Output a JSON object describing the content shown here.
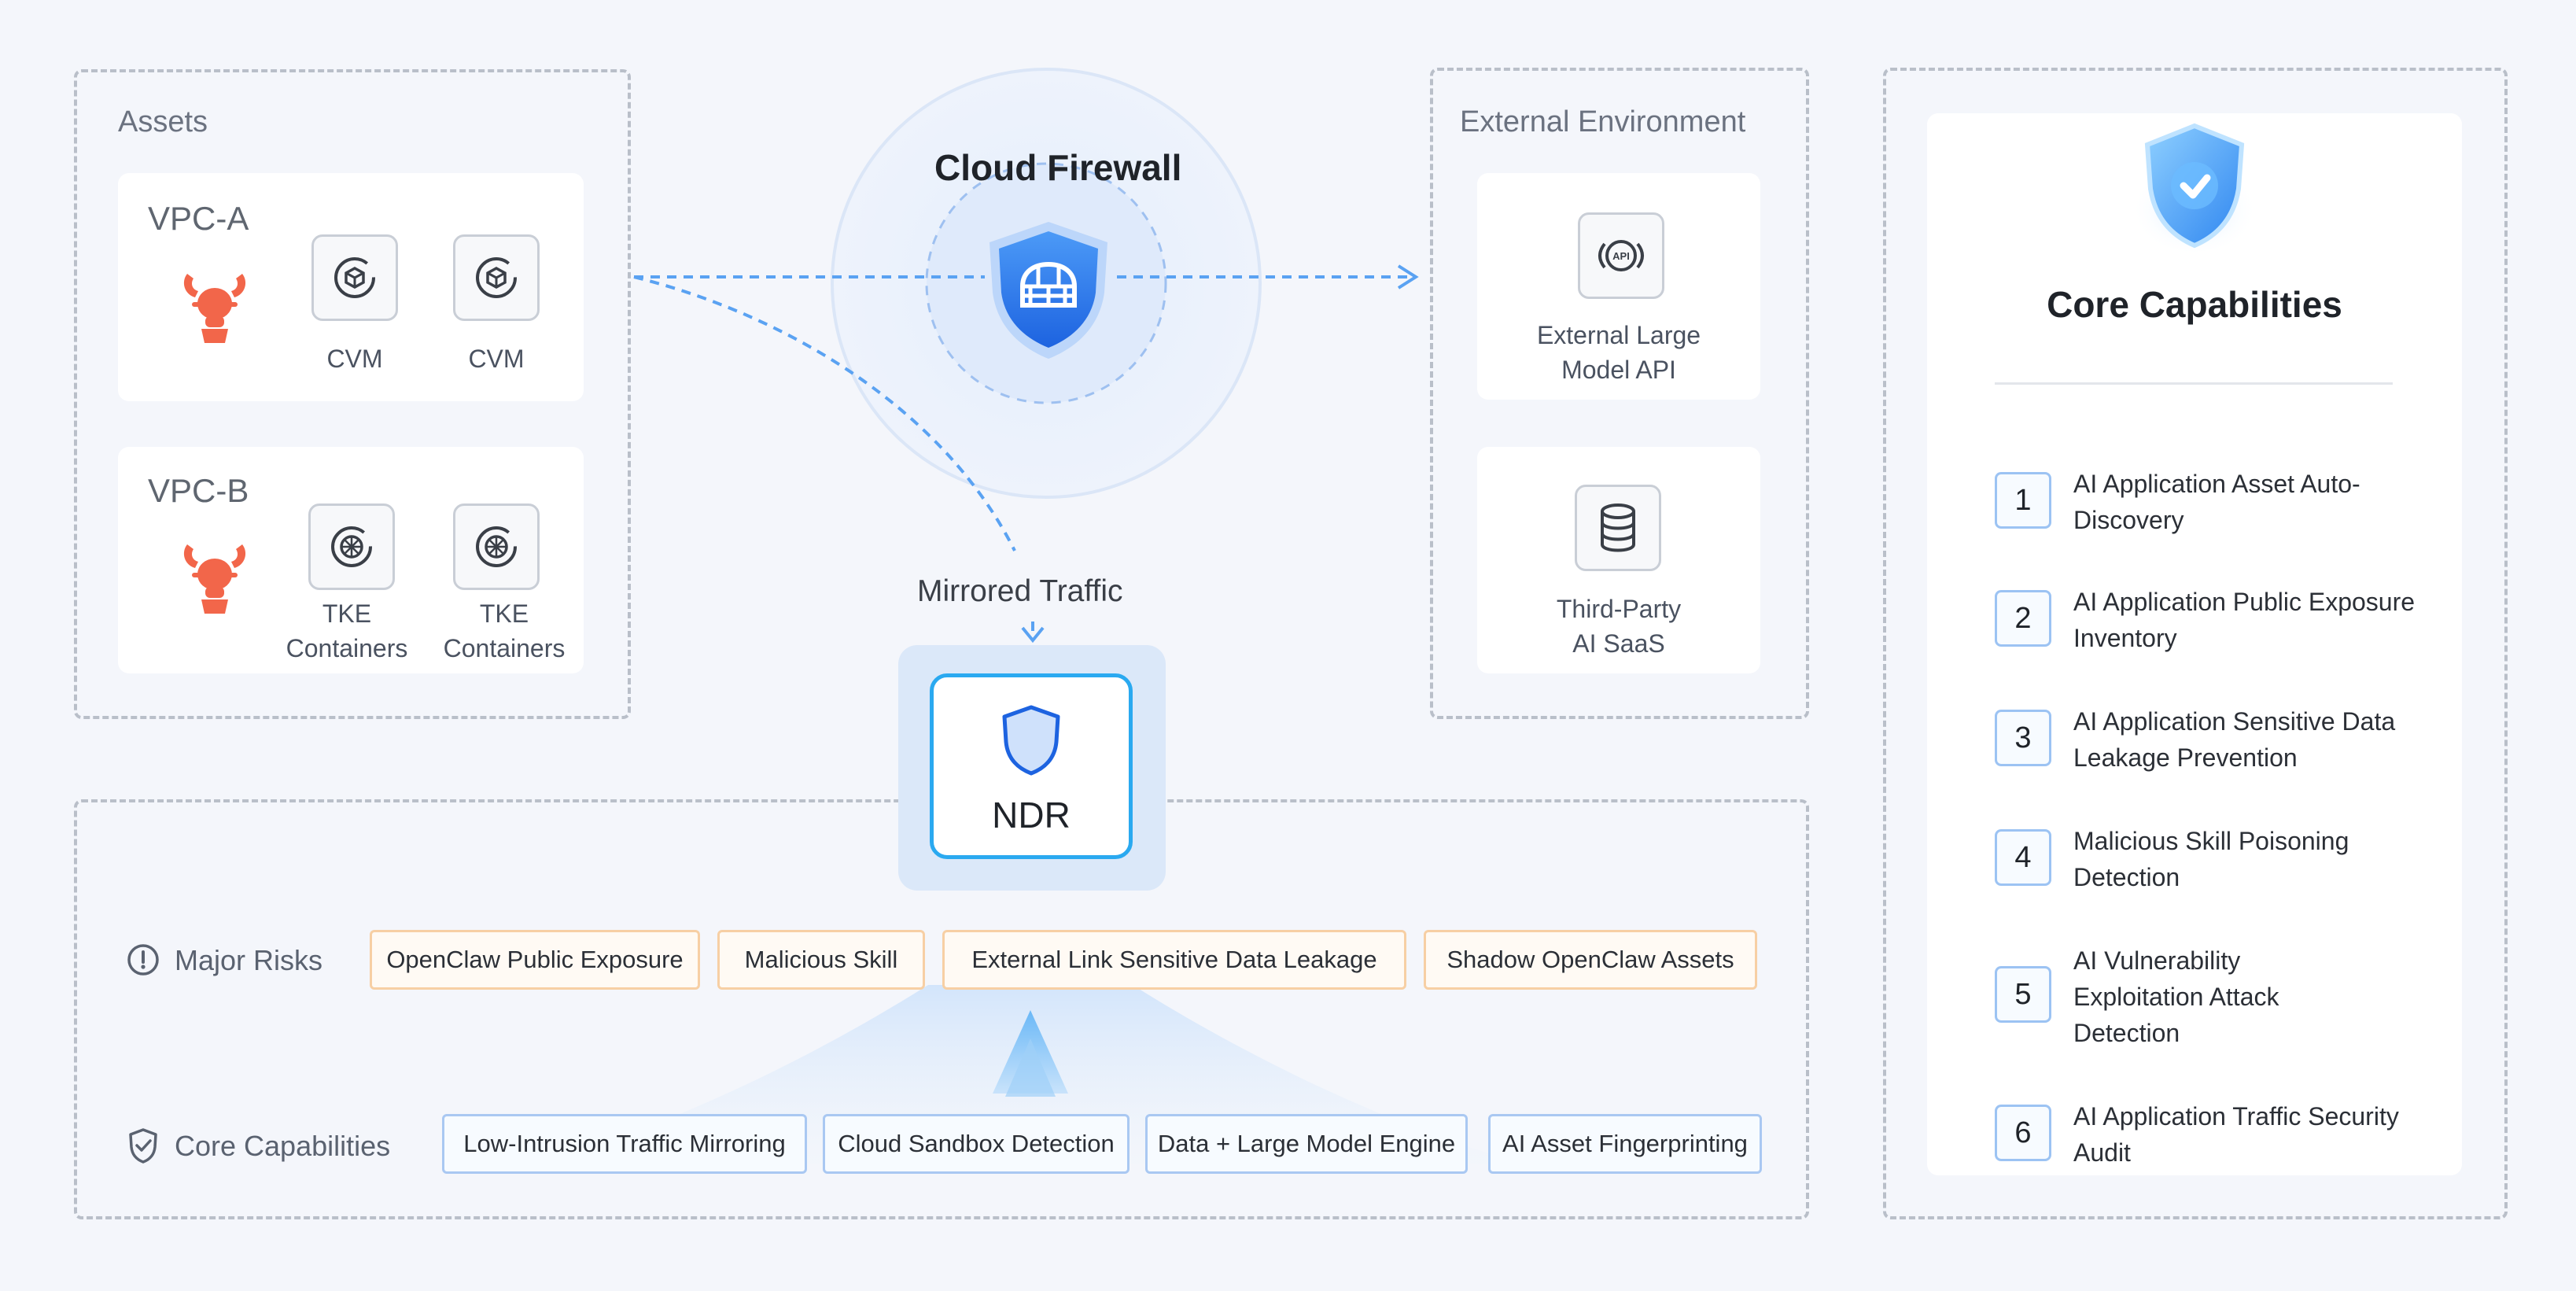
{
  "assets": {
    "title": "Assets",
    "vpc_a": {
      "title": "VPC-A",
      "nodes": [
        "CVM",
        "CVM"
      ]
    },
    "vpc_b": {
      "title": "VPC-B",
      "nodes": [
        "TKE\nContainers",
        "TKE\nContainers"
      ]
    }
  },
  "firewall": {
    "title": "Cloud Firewall"
  },
  "mirrored_label": "Mirrored Traffic",
  "ndr": {
    "label": "NDR"
  },
  "external": {
    "title": "External Environment",
    "items": [
      {
        "label": "External Large\nModel API",
        "icon": "api-icon",
        "icon_text": "API"
      },
      {
        "label": "Third-Party\nAI SaaS",
        "icon": "database-icon"
      }
    ]
  },
  "risks": {
    "label": "Major Risks",
    "items": [
      "OpenClaw Public Exposure",
      "Malicious Skill",
      "External Link Sensitive Data Leakage",
      "Shadow OpenClaw Assets"
    ]
  },
  "core_row": {
    "label": "Core Capabilities",
    "items": [
      "Low-Intrusion Traffic Mirroring",
      "Cloud Sandbox Detection",
      "Data + Large Model Engine",
      "AI Asset Fingerprinting"
    ]
  },
  "core_panel": {
    "title": "Core Capabilities",
    "items": [
      {
        "num": "1",
        "text": "AI Application Asset Auto-Discovery"
      },
      {
        "num": "2",
        "text": "AI Application Public Exposure Inventory"
      },
      {
        "num": "3",
        "text": "AI Application Sensitive Data Leakage Prevention"
      },
      {
        "num": "4",
        "text": "Malicious Skill Poisoning Detection"
      },
      {
        "num": "5",
        "text": "AI Vulnerability Exploitation Attack Detection"
      },
      {
        "num": "6",
        "text": "AI Application Traffic Security Audit"
      }
    ]
  },
  "colors": {
    "accent": "#2f7ff0",
    "lobster": "#f2664a",
    "risk_border": "#f7cfa4",
    "cap_border": "#a9c8f2"
  }
}
